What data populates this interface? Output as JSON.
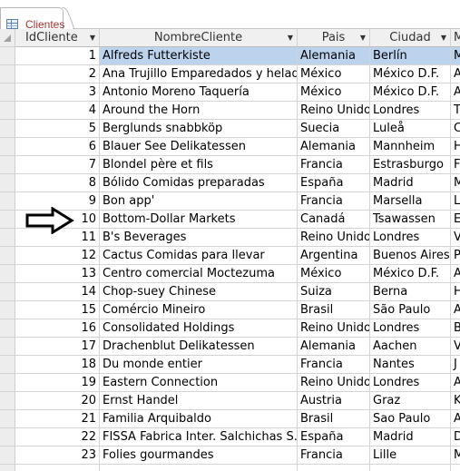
{
  "tab": {
    "label": "Clientes"
  },
  "columns": [
    {
      "label": "IdCliente"
    },
    {
      "label": "NombreCliente"
    },
    {
      "label": "Pais"
    },
    {
      "label": "Ciudad"
    },
    {
      "label": "M"
    }
  ],
  "rows": [
    {
      "id": "1",
      "name": "Alfreds Futterkiste",
      "pais": "Alemania",
      "ciudad": "Berlín",
      "extra": "M"
    },
    {
      "id": "2",
      "name": "Ana Trujillo Emparedados y helados",
      "pais": "México",
      "ciudad": "México D.F.",
      "extra": "A"
    },
    {
      "id": "3",
      "name": "Antonio Moreno Taquería",
      "pais": "México",
      "ciudad": "México D.F.",
      "extra": "A"
    },
    {
      "id": "4",
      "name": "Around the Horn",
      "pais": "Reino Unido",
      "ciudad": "Londres",
      "extra": "T"
    },
    {
      "id": "5",
      "name": "Berglunds snabbköp",
      "pais": "Suecia",
      "ciudad": "Luleå",
      "extra": "C"
    },
    {
      "id": "6",
      "name": "Blauer See Delikatessen",
      "pais": "Alemania",
      "ciudad": "Mannheim",
      "extra": "H"
    },
    {
      "id": "7",
      "name": "Blondel père et fils",
      "pais": "Francia",
      "ciudad": "Estrasburgo",
      "extra": "F"
    },
    {
      "id": "8",
      "name": "Bólido Comidas preparadas",
      "pais": "España",
      "ciudad": "Madrid",
      "extra": "M"
    },
    {
      "id": "9",
      "name": "Bon app'",
      "pais": "Francia",
      "ciudad": "Marsella",
      "extra": "L"
    },
    {
      "id": "10",
      "name": "Bottom-Dollar Markets",
      "pais": "Canadá",
      "ciudad": "Tsawassen",
      "extra": "E"
    },
    {
      "id": "11",
      "name": "B's Beverages",
      "pais": "Reino Unido",
      "ciudad": "Londres",
      "extra": "V"
    },
    {
      "id": "12",
      "name": "Cactus Comidas para llevar",
      "pais": "Argentina",
      "ciudad": "Buenos Aires",
      "extra": "P"
    },
    {
      "id": "13",
      "name": "Centro comercial Moctezuma",
      "pais": "México",
      "ciudad": "México D.F.",
      "extra": "A"
    },
    {
      "id": "14",
      "name": "Chop-suey Chinese",
      "pais": "Suiza",
      "ciudad": "Berna",
      "extra": "H"
    },
    {
      "id": "15",
      "name": "Comércio Mineiro",
      "pais": "Brasil",
      "ciudad": "São Paulo",
      "extra": "A"
    },
    {
      "id": "16",
      "name": "Consolidated Holdings",
      "pais": "Reino Unido",
      "ciudad": "Londres",
      "extra": "B"
    },
    {
      "id": "17",
      "name": "Drachenblut Delikatessen",
      "pais": "Alemania",
      "ciudad": "Aachen",
      "extra": "V"
    },
    {
      "id": "18",
      "name": "Du monde entier",
      "pais": "Francia",
      "ciudad": "Nantes",
      "extra": "J"
    },
    {
      "id": "19",
      "name": "Eastern Connection",
      "pais": "Reino Unido",
      "ciudad": "Londres",
      "extra": "A"
    },
    {
      "id": "20",
      "name": "Ernst Handel",
      "pais": "Austria",
      "ciudad": "Graz",
      "extra": "K"
    },
    {
      "id": "21",
      "name": "Familia Arquibaldo",
      "pais": "Brasil",
      "ciudad": "Sao Paulo",
      "extra": "A"
    },
    {
      "id": "22",
      "name": "FISSA Fabrica Inter. Salchichas S.A.",
      "pais": "España",
      "ciudad": "Madrid",
      "extra": "D"
    },
    {
      "id": "23",
      "name": "Folies gourmandes",
      "pais": "Francia",
      "ciudad": "Lille",
      "extra": "M"
    }
  ],
  "selected_row": 1,
  "arrow_row": 10,
  "colors": {
    "selection": "#bcd3ee",
    "tab_label": "#a83232",
    "header_bg": "#f0f0f0"
  }
}
